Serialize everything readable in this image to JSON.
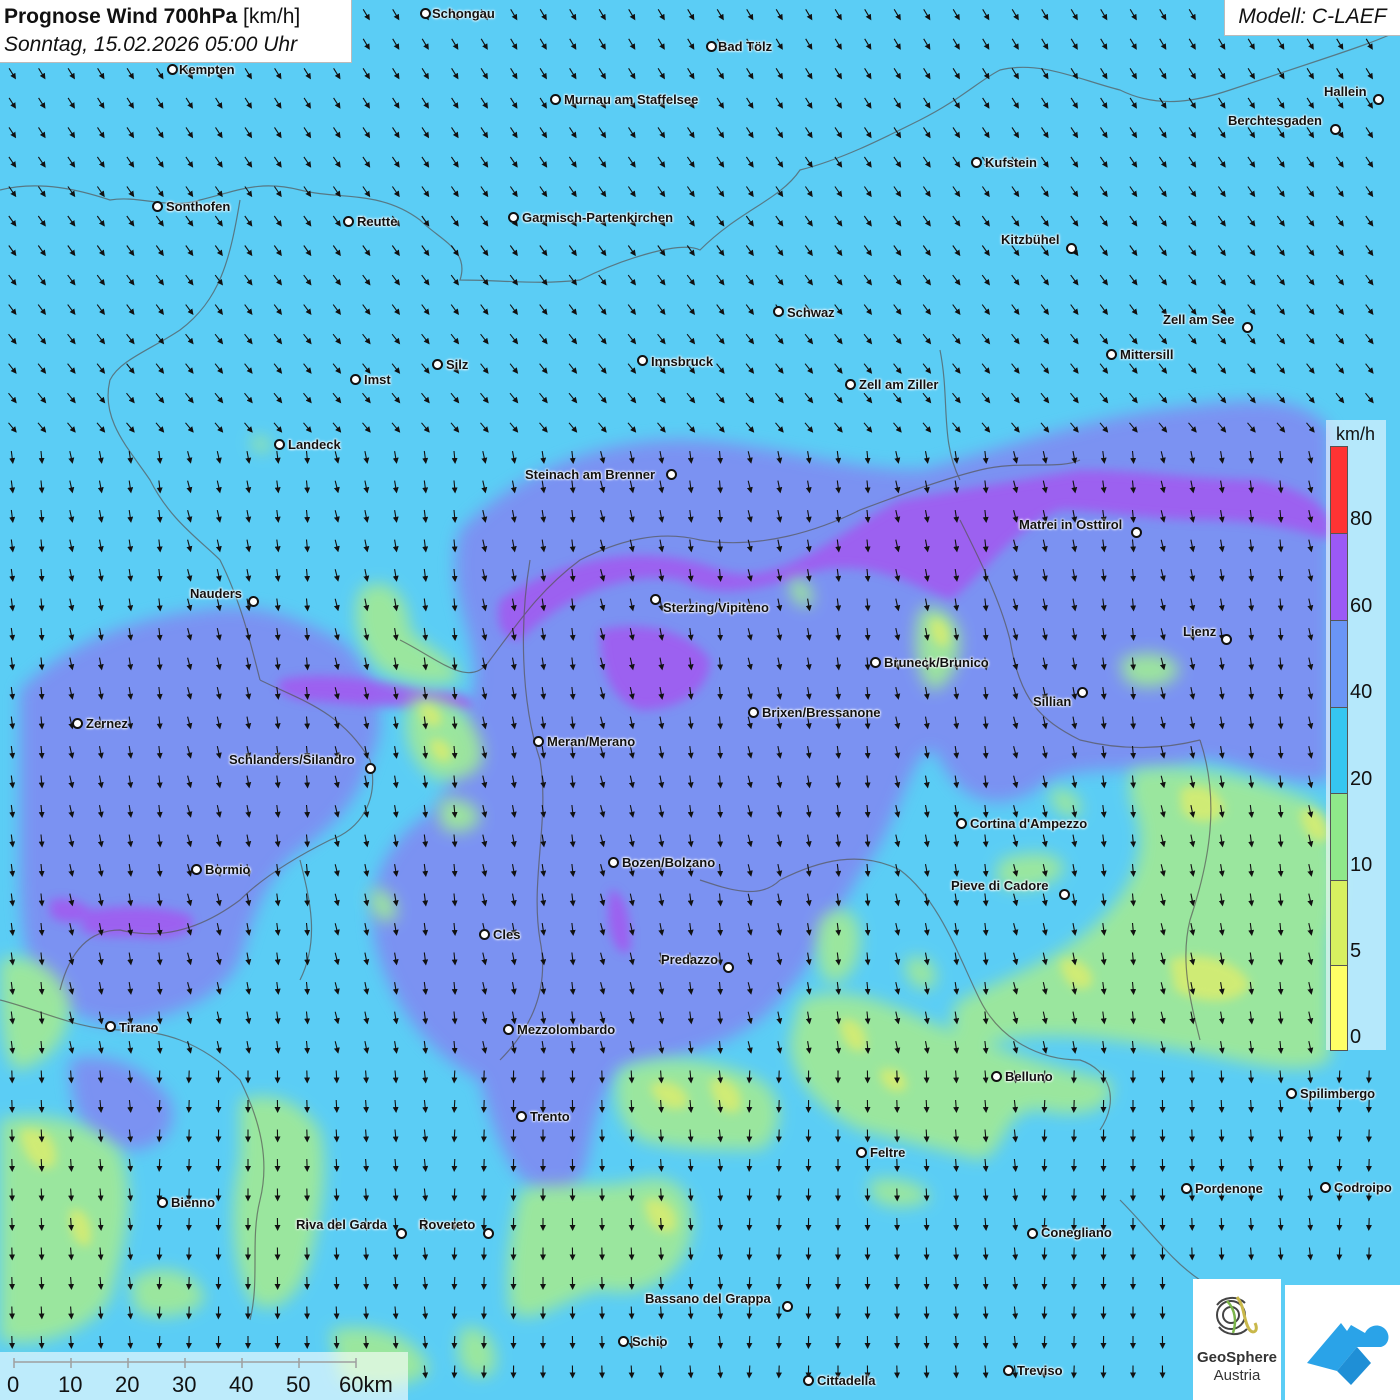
{
  "header": {
    "title_bold": "Prognose Wind 700hPa",
    "title_unit": "[km/h]",
    "datetime": "Sonntag, 15.02.2026 05:00 Uhr",
    "model": "Modell: C-LAEF"
  },
  "legend": {
    "unit": "km/h",
    "labels": [
      "80",
      "60",
      "40",
      "20",
      "10",
      "5",
      "0"
    ],
    "colors": [
      "#ff3333",
      "#9b59f5",
      "#6a95f5",
      "#36c6f0",
      "#8fe88a",
      "#d8f060",
      "#ffff66"
    ]
  },
  "scale": {
    "labels": [
      "0",
      "10",
      "20",
      "30",
      "40",
      "50",
      "60km"
    ]
  },
  "logos": {
    "geosphere_line1": "GeoSphere",
    "geosphere_line2": "Austria"
  },
  "cities": [
    {
      "name": "Schongau"
    },
    {
      "name": "Bad Tölz"
    },
    {
      "name": "Kempten"
    },
    {
      "name": "Murnau am Staffelsee"
    },
    {
      "name": "Hallein"
    },
    {
      "name": "Berchtesgaden"
    },
    {
      "name": "Kufstein"
    },
    {
      "name": "Sonthofen"
    },
    {
      "name": "Reutte"
    },
    {
      "name": "Garmisch-Partenkirchen"
    },
    {
      "name": "Kitzbühel"
    },
    {
      "name": "Schwaz"
    },
    {
      "name": "Zell am See"
    },
    {
      "name": "Mittersill"
    },
    {
      "name": "Innsbruck"
    },
    {
      "name": "Silz"
    },
    {
      "name": "Imst"
    },
    {
      "name": "Zell am Ziller"
    },
    {
      "name": "Landeck"
    },
    {
      "name": "Steinach am Brenner"
    },
    {
      "name": "Matrei in Osttirol"
    },
    {
      "name": "Nauders"
    },
    {
      "name": "Sterzing/Vipiteno"
    },
    {
      "name": "Lienz"
    },
    {
      "name": "Bruneck/Brunico"
    },
    {
      "name": "Sillian"
    },
    {
      "name": "Brixen/Bressanone"
    },
    {
      "name": "Zernez"
    },
    {
      "name": "Meran/Merano"
    },
    {
      "name": "Schlanders/Silandro"
    },
    {
      "name": "Cortina d'Ampezzo"
    },
    {
      "name": "Bozen/Bolzano"
    },
    {
      "name": "Bormio"
    },
    {
      "name": "Pieve di Cadore"
    },
    {
      "name": "Cles"
    },
    {
      "name": "Predazzo"
    },
    {
      "name": "Tirano"
    },
    {
      "name": "Mezzolombardo"
    },
    {
      "name": "Belluno"
    },
    {
      "name": "Spilimbergo"
    },
    {
      "name": "Trento"
    },
    {
      "name": "Feltre"
    },
    {
      "name": "Pordenone"
    },
    {
      "name": "Codroipo"
    },
    {
      "name": "Bienno"
    },
    {
      "name": "Riva del Garda"
    },
    {
      "name": "Rovereto"
    },
    {
      "name": "Conegliano"
    },
    {
      "name": "Bassano del Grappa"
    },
    {
      "name": "Schio"
    },
    {
      "name": "Treviso"
    },
    {
      "name": "Cittadella"
    }
  ]
}
